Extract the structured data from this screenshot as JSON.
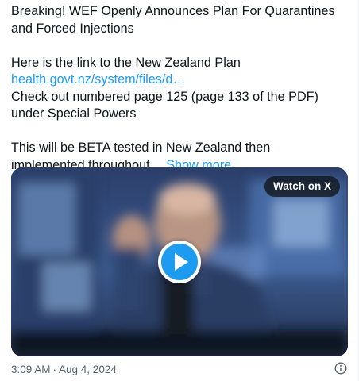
{
  "tweet": {
    "text_lines": [
      "Breaking! WEF Openly Announces Plan For Quarantines",
      "and Forced Injections",
      "Here is the link to the New Zealand Plan"
    ],
    "link_text": "health.govt.nz/system/files/d…",
    "text_after_link": [
      "Check out numbered page 125 (page 133 of the PDF)",
      "under Special Powers",
      "This will be BETA tested in New Zealand then",
      "implemented throughout…"
    ],
    "show_more_label": "Show more"
  },
  "media": {
    "type": "video",
    "watch_badge_label": "Watch on X",
    "play_icon": "play-icon"
  },
  "meta": {
    "time": "3:09 AM",
    "separator": "·",
    "date": "Aug 4, 2024",
    "info_icon": "info-icon"
  },
  "colors": {
    "link": "#1d9bf0",
    "text": "#0f1419",
    "secondary": "#536471",
    "play_button": "#1d9bf0"
  }
}
